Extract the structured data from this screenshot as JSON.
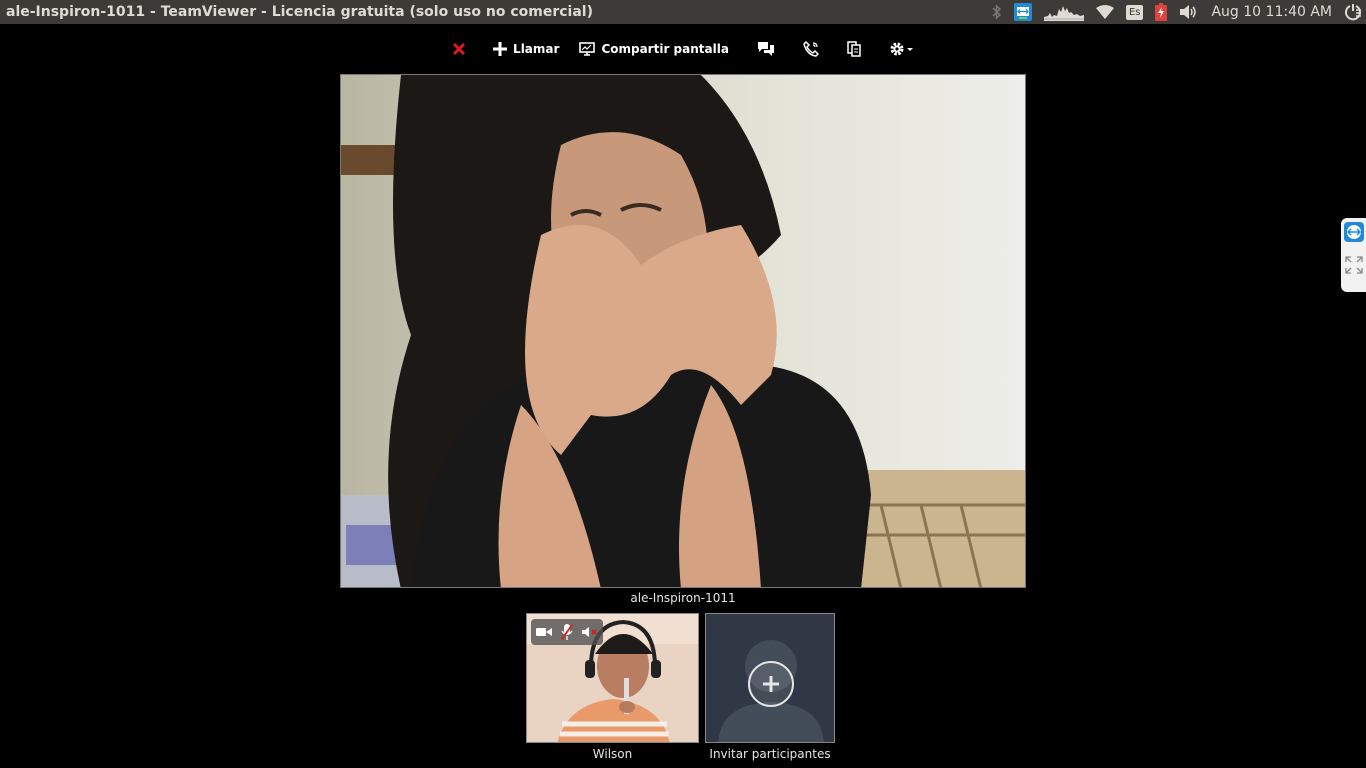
{
  "window": {
    "title": "ale-Inspiron-1011 - TeamViewer - Licencia gratuita (solo uso no comercial)"
  },
  "tray": {
    "icons": [
      "bluetooth-icon",
      "teamviewer-tray-icon",
      "system-monitor-icon",
      "wifi-icon",
      "keyboard-layout-indicator",
      "battery-icon",
      "volume-icon",
      "power-icon"
    ],
    "keyboard_layout": "Es",
    "clock": "Aug 10 11:40 AM"
  },
  "toolbar": {
    "close_icon": "close-icon",
    "call_label": "Llamar",
    "share_screen_label": "Compartir pantalla",
    "icons": [
      "plus-icon",
      "monitor-icon",
      "chat-icon",
      "phone-icon",
      "files-icon",
      "gear-icon"
    ]
  },
  "main": {
    "participant_name": "ale-Inspiron-1011"
  },
  "participants": [
    {
      "name": "Wilson",
      "controls": [
        "camera-icon",
        "mic-muted-icon",
        "speaker-muted-icon"
      ]
    },
    {
      "name": "Invitar participantes"
    }
  ],
  "colors": {
    "close": "#d81b1b",
    "topbar": "#3c3b37",
    "placeholder_bg": "#2f3844"
  }
}
